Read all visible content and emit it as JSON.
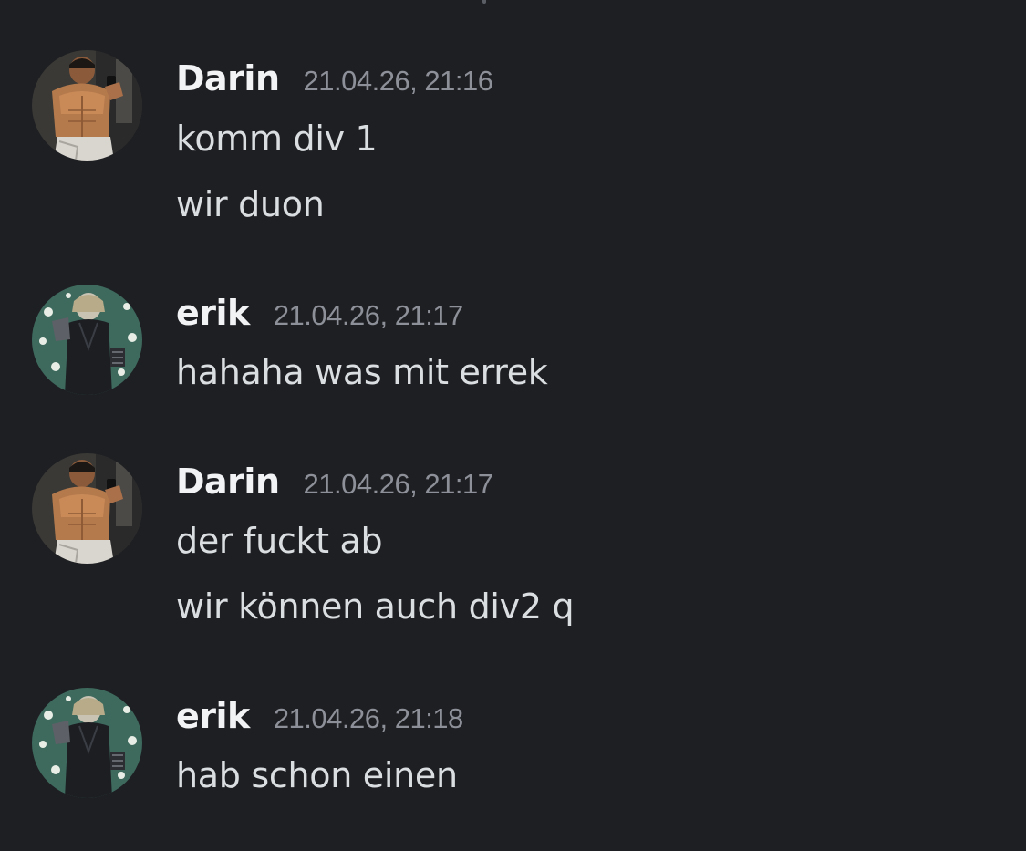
{
  "messages": [
    {
      "author": "Darin",
      "timestamp": "21.04.26, 21:16",
      "avatar": "darin-avatar",
      "lines": [
        "komm div 1",
        "wir duon"
      ]
    },
    {
      "author": "erik",
      "timestamp": "21.04.26, 21:17",
      "avatar": "erik-avatar",
      "lines": [
        "hahaha was mit errek"
      ]
    },
    {
      "author": "Darin",
      "timestamp": "21.04.26, 21:17",
      "avatar": "darin-avatar",
      "lines": [
        "der fuckt ab",
        "wir können auch div2 q"
      ]
    },
    {
      "author": "erik",
      "timestamp": "21.04.26, 21:18",
      "avatar": "erik-avatar",
      "lines": [
        "hab schon einen"
      ]
    }
  ],
  "colors": {
    "background": "#1e1f22",
    "username": "#f2f3f5",
    "timestamp": "#8e9099",
    "message_text": "#dbdee1"
  }
}
